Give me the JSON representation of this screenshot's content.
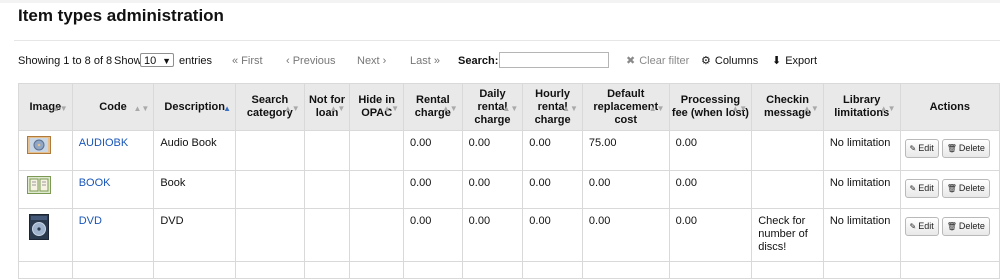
{
  "page": {
    "title": "Item types administration"
  },
  "toolbar": {
    "info": "Showing 1 to 8 of 8",
    "show_label": "Show",
    "page_size": "10",
    "entries_label": "entries",
    "first": "« First",
    "previous": "‹ Previous",
    "next": "Next ›",
    "last": "Last »",
    "search_label": "Search:",
    "search_value": "",
    "clear_filter": "Clear filter",
    "columns": "Columns",
    "export": "Export"
  },
  "table": {
    "headers": {
      "image": "Image",
      "code": "Code",
      "description": "Description",
      "search_category": "Search category",
      "not_for_loan": "Not for loan",
      "hide_in_opac": "Hide in OPAC",
      "rental_charge": "Rental charge",
      "daily_rental_charge": "Daily rental charge",
      "hourly_rental_charge": "Hourly rental charge",
      "default_replacement_cost": "Default replacement cost",
      "processing_fee": "Processing fee (when lost)",
      "checkin_message": "Checkin message",
      "library_limitations": "Library limitations",
      "actions": "Actions"
    },
    "rows": [
      {
        "icon": "audiobook-icon",
        "code": "AUDIOBK",
        "description": "Audio Book",
        "search_category": "",
        "not_for_loan": "",
        "hide_in_opac": "",
        "rental_charge": "0.00",
        "daily_rental_charge": "0.00",
        "hourly_rental_charge": "0.00",
        "default_replacement_cost": "75.00",
        "processing_fee": "0.00",
        "checkin_message": "",
        "library_limitations": "No limitation",
        "edit_label": "Edit",
        "delete_label": "Delete"
      },
      {
        "icon": "book-icon",
        "code": "BOOK",
        "description": "Book",
        "search_category": "",
        "not_for_loan": "",
        "hide_in_opac": "",
        "rental_charge": "0.00",
        "daily_rental_charge": "0.00",
        "hourly_rental_charge": "0.00",
        "default_replacement_cost": "0.00",
        "processing_fee": "0.00",
        "checkin_message": "",
        "library_limitations": "No limitation",
        "edit_label": "Edit",
        "delete_label": "Delete"
      },
      {
        "icon": "dvd-icon",
        "code": "DVD",
        "description": "DVD",
        "search_category": "",
        "not_for_loan": "",
        "hide_in_opac": "",
        "rental_charge": "0.00",
        "daily_rental_charge": "0.00",
        "hourly_rental_charge": "0.00",
        "default_replacement_cost": "0.00",
        "processing_fee": "0.00",
        "checkin_message": "Check for number of discs!",
        "library_limitations": "No limitation",
        "edit_label": "Edit",
        "delete_label": "Delete"
      }
    ]
  },
  "colors": {
    "link": "#1a56b8",
    "header_bg": "#e9e9e9",
    "sort_active": "#3a6fc4"
  }
}
